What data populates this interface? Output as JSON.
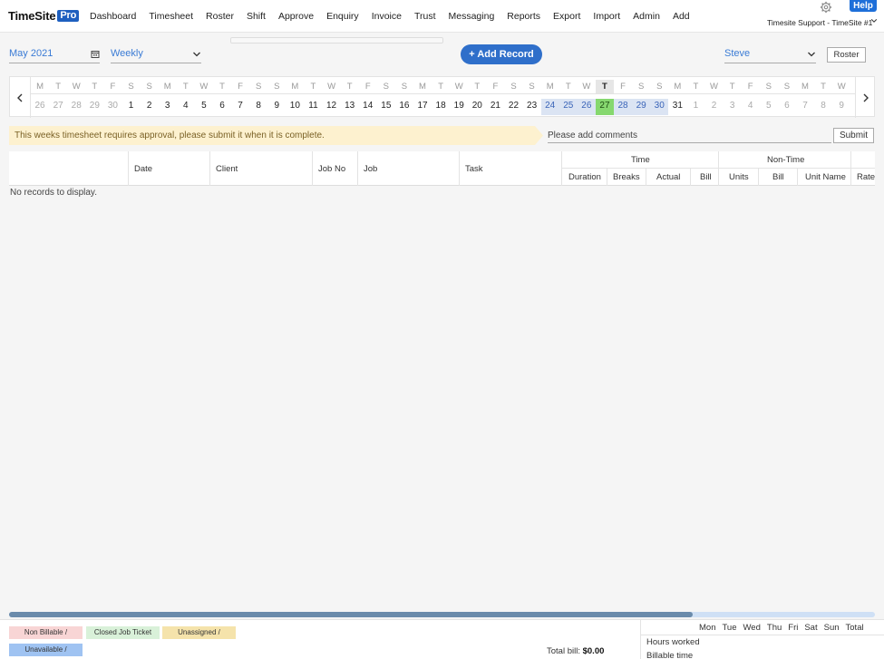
{
  "brand": {
    "name": "TimeSite",
    "badge": "Pro"
  },
  "nav": [
    "Dashboard",
    "Timesheet",
    "Roster",
    "Shift",
    "Approve",
    "Enquiry",
    "Invoice",
    "Trust",
    "Messaging",
    "Reports",
    "Export",
    "Import",
    "Admin",
    "Add"
  ],
  "help_label": "Help",
  "account_label": "Timesite Support - TimeSite #1",
  "filters": {
    "month": "May 2021",
    "period": "Weekly",
    "person": "Steve"
  },
  "add_record_label": "+ Add Record",
  "roster_label": "Roster",
  "calendar": {
    "dows": [
      "M",
      "T",
      "W",
      "T",
      "F",
      "S",
      "S",
      "M",
      "T",
      "W",
      "T",
      "F",
      "S",
      "S",
      "M",
      "T",
      "W",
      "T",
      "F",
      "S",
      "S",
      "M",
      "T",
      "W",
      "T",
      "F",
      "S",
      "S",
      "M",
      "T",
      "W",
      "T",
      "F",
      "S",
      "S",
      "M",
      "T",
      "W",
      "T",
      "F",
      "S",
      "S",
      "M",
      "T",
      "W"
    ],
    "days": [
      "26",
      "27",
      "28",
      "29",
      "30",
      "1",
      "2",
      "3",
      "4",
      "5",
      "6",
      "7",
      "8",
      "9",
      "10",
      "11",
      "12",
      "13",
      "14",
      "15",
      "16",
      "17",
      "18",
      "19",
      "20",
      "21",
      "22",
      "23",
      "24",
      "25",
      "26",
      "27",
      "28",
      "29",
      "30",
      "31",
      "1",
      "2",
      "3",
      "4",
      "5",
      "6",
      "7",
      "8",
      "9"
    ],
    "muted_ranges": [
      [
        0,
        4
      ],
      [
        36,
        44
      ]
    ],
    "week_range": [
      28,
      34
    ],
    "today_index": 31
  },
  "notice": "This weeks timesheet requires approval, please submit it when it is complete.",
  "comments_placeholder": "Please add comments",
  "submit_label": "Submit",
  "grid": {
    "columns": {
      "date": "Date",
      "client": "Client",
      "job_no": "Job No",
      "job": "Job",
      "task": "Task"
    },
    "time_group": "Time",
    "time_cols": {
      "duration": "Duration",
      "breaks": "Breaks",
      "actual": "Actual",
      "bill": "Bill"
    },
    "nontime_group": "Non-Time",
    "nontime_cols": {
      "units": "Units",
      "bill": "Bill",
      "unit_name": "Unit Name",
      "rate": "Rate"
    },
    "empty_text": "No records to display.",
    "scroll_fraction": 0.79
  },
  "legend": {
    "non_billable": "Non Billable /",
    "closed_job": "Closed Job Ticket",
    "unassigned": "Unassigned /",
    "unavailable": "Unavailable /"
  },
  "total_bill": {
    "label": "Total bill:",
    "value": "$0.00"
  },
  "summary": {
    "days": [
      "Mon",
      "Tue",
      "Wed",
      "Thu",
      "Fri",
      "Sat",
      "Sun",
      "Total"
    ],
    "rows": [
      "Hours worked",
      "Billable time"
    ]
  }
}
